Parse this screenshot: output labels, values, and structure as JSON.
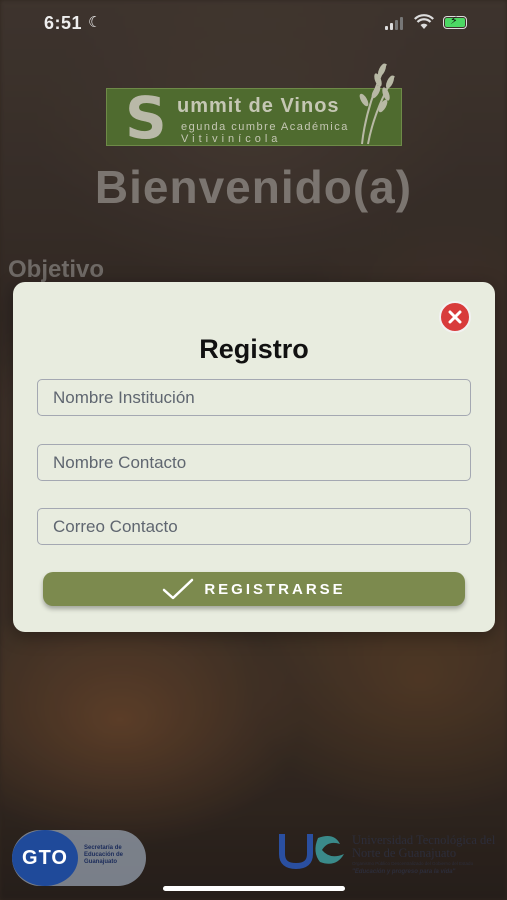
{
  "status_bar": {
    "time": "6:51"
  },
  "logo": {
    "initial": "S",
    "line1": "ummit de Vinos",
    "line2": "egunda cumbre Académica",
    "line3": "Vitivinícola"
  },
  "welcome": "Bienvenido(a)",
  "objetivo": "Objetivo",
  "modal": {
    "title": "Registro",
    "fields": [
      {
        "placeholder": "Nombre Institución"
      },
      {
        "placeholder": "Nombre Contacto"
      },
      {
        "placeholder": "Correo Contacto"
      }
    ],
    "submit_label": "REGISTRARSE"
  },
  "footer": {
    "gto_mark": "GTO",
    "gto_text": "Secretaría de Educación de Guanajuato",
    "utng_name": "Universidad Tecnológica del Norte de Guanajuato",
    "utng_sub": "Organismo Público Descentralizado del Gobierno del Estado",
    "utng_motto": "\"Educación y progreso para la vida\""
  },
  "colors": {
    "accent": "#7c8a4e",
    "modal_bg": "#e8ecdf",
    "close": "#d83b3b",
    "logo_bg": "#4f6b2f"
  }
}
